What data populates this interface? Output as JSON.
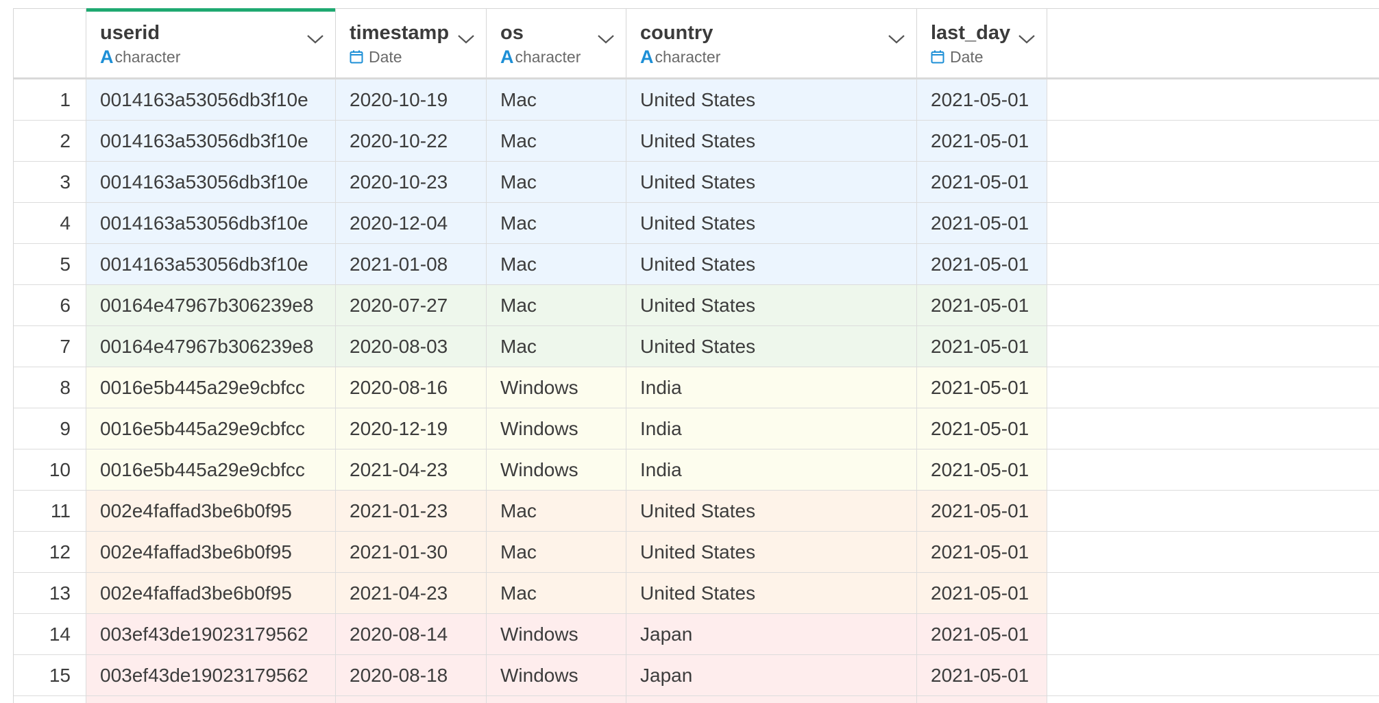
{
  "columns": [
    {
      "name": "userid",
      "type": "character",
      "type_icon": "character-type-icon"
    },
    {
      "name": "timestamp",
      "type": "Date",
      "type_icon": "calendar-icon"
    },
    {
      "name": "os",
      "type": "character",
      "type_icon": "character-type-icon"
    },
    {
      "name": "country",
      "type": "character",
      "type_icon": "character-type-icon"
    },
    {
      "name": "last_day",
      "type": "Date",
      "type_icon": "calendar-icon"
    }
  ],
  "colors": {
    "selected_column_accent": "#1fa971",
    "type_icon_blue": "#1d8fd6",
    "group_colors": [
      "#ecf5fe",
      "#eef7ec",
      "#fdfdee",
      "#fef3e9",
      "#feeded"
    ]
  },
  "rows": [
    {
      "idx": "1",
      "userid": "0014163a53056db3f10e",
      "timestamp": "2020-10-19",
      "os": "Mac",
      "country": "United States",
      "last_day": "2021-05-01",
      "group": 0
    },
    {
      "idx": "2",
      "userid": "0014163a53056db3f10e",
      "timestamp": "2020-10-22",
      "os": "Mac",
      "country": "United States",
      "last_day": "2021-05-01",
      "group": 0
    },
    {
      "idx": "3",
      "userid": "0014163a53056db3f10e",
      "timestamp": "2020-10-23",
      "os": "Mac",
      "country": "United States",
      "last_day": "2021-05-01",
      "group": 0
    },
    {
      "idx": "4",
      "userid": "0014163a53056db3f10e",
      "timestamp": "2020-12-04",
      "os": "Mac",
      "country": "United States",
      "last_day": "2021-05-01",
      "group": 0
    },
    {
      "idx": "5",
      "userid": "0014163a53056db3f10e",
      "timestamp": "2021-01-08",
      "os": "Mac",
      "country": "United States",
      "last_day": "2021-05-01",
      "group": 0
    },
    {
      "idx": "6",
      "userid": "00164e47967b306239e8",
      "timestamp": "2020-07-27",
      "os": "Mac",
      "country": "United States",
      "last_day": "2021-05-01",
      "group": 1
    },
    {
      "idx": "7",
      "userid": "00164e47967b306239e8",
      "timestamp": "2020-08-03",
      "os": "Mac",
      "country": "United States",
      "last_day": "2021-05-01",
      "group": 1
    },
    {
      "idx": "8",
      "userid": "0016e5b445a29e9cbfcc",
      "timestamp": "2020-08-16",
      "os": "Windows",
      "country": "India",
      "last_day": "2021-05-01",
      "group": 2
    },
    {
      "idx": "9",
      "userid": "0016e5b445a29e9cbfcc",
      "timestamp": "2020-12-19",
      "os": "Windows",
      "country": "India",
      "last_day": "2021-05-01",
      "group": 2
    },
    {
      "idx": "10",
      "userid": "0016e5b445a29e9cbfcc",
      "timestamp": "2021-04-23",
      "os": "Windows",
      "country": "India",
      "last_day": "2021-05-01",
      "group": 2
    },
    {
      "idx": "11",
      "userid": "002e4faffad3be6b0f95",
      "timestamp": "2021-01-23",
      "os": "Mac",
      "country": "United States",
      "last_day": "2021-05-01",
      "group": 3
    },
    {
      "idx": "12",
      "userid": "002e4faffad3be6b0f95",
      "timestamp": "2021-01-30",
      "os": "Mac",
      "country": "United States",
      "last_day": "2021-05-01",
      "group": 3
    },
    {
      "idx": "13",
      "userid": "002e4faffad3be6b0f95",
      "timestamp": "2021-04-23",
      "os": "Mac",
      "country": "United States",
      "last_day": "2021-05-01",
      "group": 3
    },
    {
      "idx": "14",
      "userid": "003ef43de19023179562",
      "timestamp": "2020-08-14",
      "os": "Windows",
      "country": "Japan",
      "last_day": "2021-05-01",
      "group": 4
    },
    {
      "idx": "15",
      "userid": "003ef43de19023179562",
      "timestamp": "2020-08-18",
      "os": "Windows",
      "country": "Japan",
      "last_day": "2021-05-01",
      "group": 4
    }
  ]
}
